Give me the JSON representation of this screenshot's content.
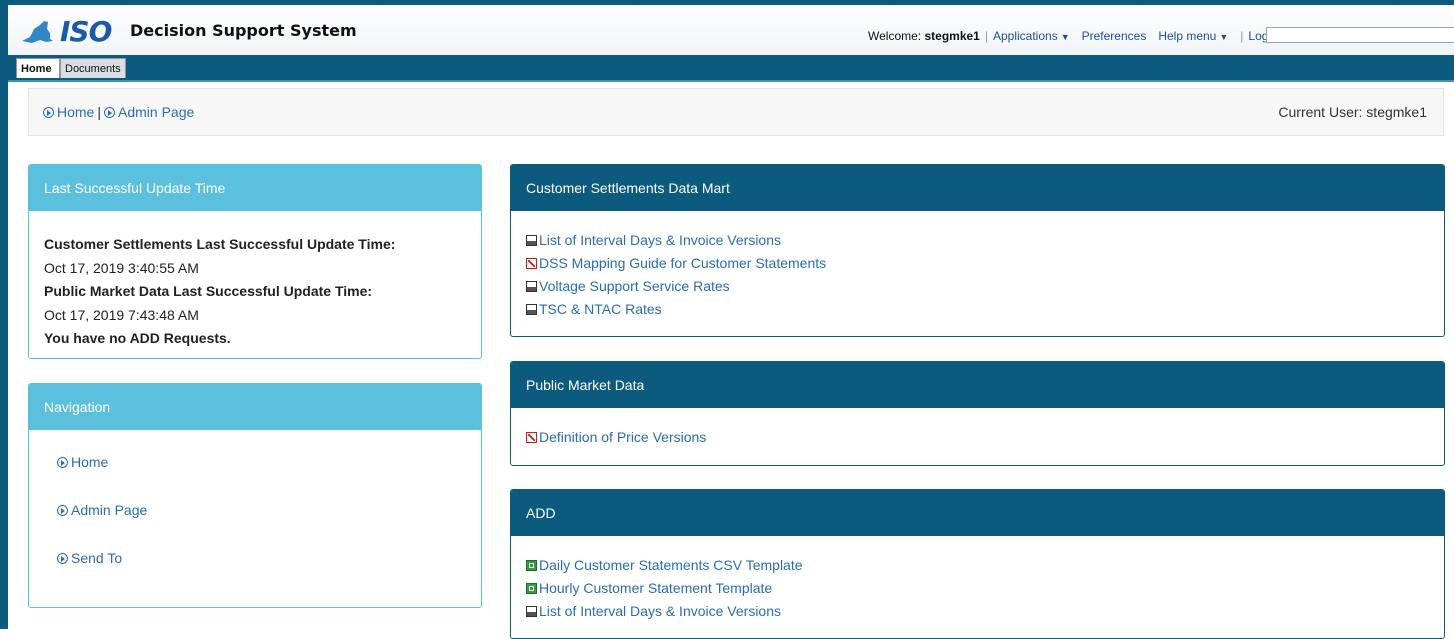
{
  "header": {
    "logo_text": "ISO",
    "app_title": "Decision Support System",
    "welcome_label": "Welcome:",
    "username": "stegmke1",
    "applications": "Applications",
    "preferences": "Preferences",
    "help_menu": "Help menu",
    "log_off": "Log off"
  },
  "tabs": [
    {
      "label": "Home",
      "active": true
    },
    {
      "label": "Documents",
      "active": false
    }
  ],
  "breadcrumb": {
    "items": [
      "Home",
      "Admin Page"
    ],
    "separator": "|",
    "current_user": "Current User: stegmke1"
  },
  "last_update": {
    "title": "Last Successful Update Time",
    "cs_label": "Customer Settlements Last Successful Update Time:",
    "cs_time": "Oct 17, 2019 3:40:55 AM",
    "pm_label": "Public Market Data Last Successful Update Time:",
    "pm_time": "Oct 17, 2019 7:43:48 AM",
    "add_message": "You have no ADD Requests."
  },
  "navigation": {
    "title": "Navigation",
    "items": [
      "Home",
      "Admin Page",
      "Send To"
    ]
  },
  "cs_data_mart": {
    "title": "Customer Settlements Data Mart",
    "links": [
      {
        "icon": "document-icon",
        "label": "List of Interval Days & Invoice Versions"
      },
      {
        "icon": "pdf-icon",
        "label": "DSS Mapping Guide for Customer Statements"
      },
      {
        "icon": "document-icon",
        "label": "Voltage Support Service Rates"
      },
      {
        "icon": "document-icon",
        "label": "TSC & NTAC Rates"
      }
    ]
  },
  "public_market": {
    "title": "Public Market Data",
    "links": [
      {
        "icon": "pdf-icon",
        "label": "Definition of Price Versions"
      }
    ]
  },
  "add_panel": {
    "title": "ADD",
    "links": [
      {
        "icon": "excel-icon",
        "label": "Daily Customer Statements CSV Template"
      },
      {
        "icon": "excel-icon",
        "label": "Hourly Customer Statement Template"
      },
      {
        "icon": "document-icon",
        "label": "List of Interval Days & Invoice Versions"
      }
    ]
  },
  "colors": {
    "primary_dark": "#0c5b7e",
    "panel_light": "#5bc0de",
    "link": "#2a6db4"
  }
}
